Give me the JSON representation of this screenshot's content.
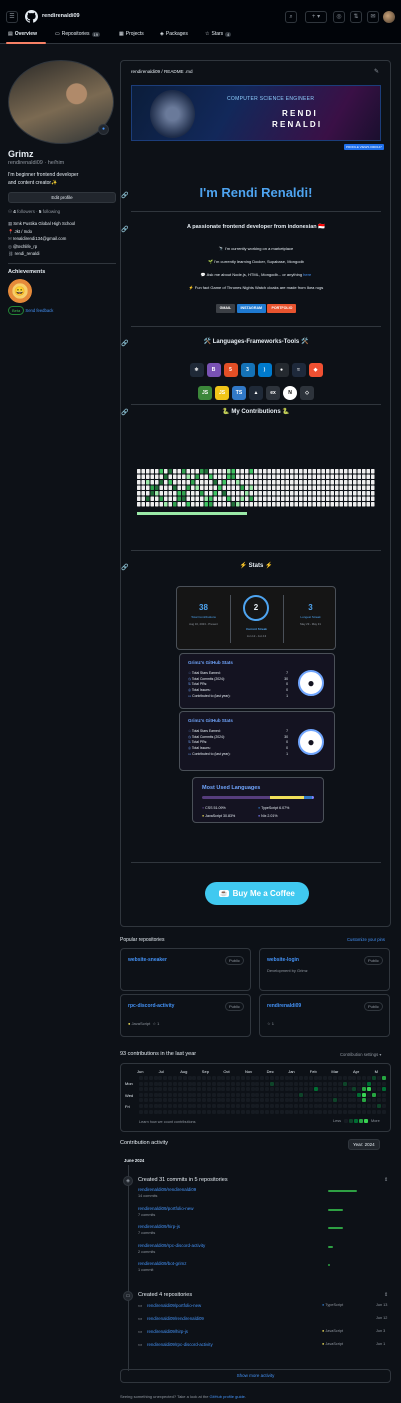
{
  "header": {
    "username": "rendirenaldi09",
    "plus": "+"
  },
  "tabs": [
    {
      "label": "Overview",
      "count": ""
    },
    {
      "label": "Repositories",
      "count": "19"
    },
    {
      "label": "Projects",
      "count": ""
    },
    {
      "label": "Packages",
      "count": ""
    },
    {
      "label": "Stars",
      "count": "4"
    }
  ],
  "profile": {
    "name": "Grimz",
    "login": "rendirenaldi09",
    "pronouns": "he/him",
    "bio_line1": "I'm beginner frontend developer",
    "bio_line2": "and content creator✨",
    "edit_button": "Edit profile",
    "followers_count": "4",
    "followers_label": "followers",
    "following_count": "5",
    "following_label": "following",
    "school": "Smk Pustika Global High School",
    "location": "📍 Jkt / Indo",
    "email": "renaldirendi134@gmail.com",
    "twitter": "@techlife_rp",
    "website": "rendi_renaldi",
    "achievements_title": "Achievements",
    "beta_badge": "Beta",
    "send_feedback": "Send feedback"
  },
  "readme": {
    "path": "rendirenaldi09 / README .md",
    "banner_title": "COMPUTER SCIENCE ENGINEER",
    "banner_name1": "R E N D I",
    "banner_name2": "R E N A L D I",
    "banner_badge": "PROFILE VIEWS 0000147",
    "heading": "I'm Rendi Renaldi!",
    "intro": "A passionate frontend developer from indonesian 🇮🇩",
    "bullet1": "🔭 I'm currently working on a marketplace",
    "bullet2": "🌱 I'm currently learning Docker, Supabase, Mongodb",
    "bullet3a": "💬 Ask me about Node.js, HTML, Mongodb... or anything ",
    "bullet3b": "here",
    "bullet4": "⚡ Fun fact Game of Thrones Nights Watch cloaks are made from Ikea rugs",
    "badges": [
      {
        "label": "GMAIL",
        "color": "#3b3f45"
      },
      {
        "label": "INSTAGRAM",
        "color": "#1f7ad1"
      },
      {
        "label": "PORTFOLIO",
        "color": "#e8542f"
      }
    ],
    "lang_heading": "🛠️ Languages-Frameworks-Tools 🛠️",
    "tech_row1": [
      {
        "icon": "react-icon",
        "glyph": "⚛",
        "color": "#1f2937"
      },
      {
        "icon": "bootstrap-icon",
        "glyph": "B",
        "color": "#7952b3"
      },
      {
        "icon": "html5-icon",
        "glyph": "5",
        "color": "#e34f26"
      },
      {
        "icon": "css3-icon",
        "glyph": "3",
        "color": "#1572b6"
      },
      {
        "icon": "vscode-icon",
        "glyph": "⟩",
        "color": "#007acc"
      },
      {
        "icon": "github-icon",
        "glyph": "●",
        "color": "#24292f"
      },
      {
        "icon": "tailwind-icon",
        "glyph": "≈",
        "color": "#1e293b"
      },
      {
        "icon": "git-icon",
        "glyph": "◆",
        "color": "#f05032"
      }
    ],
    "tech_row2": [
      {
        "icon": "nodejs-icon",
        "glyph": "JS",
        "color": "#3c873a"
      },
      {
        "icon": "javascript-icon",
        "glyph": "JS",
        "color": "#f0c419"
      },
      {
        "icon": "typescript-icon",
        "glyph": "TS",
        "color": "#3178c6"
      },
      {
        "icon": "mongodb-icon",
        "glyph": "▲",
        "color": "#1f2937"
      },
      {
        "icon": "express-icon",
        "glyph": "ex",
        "color": "#2d333b"
      },
      {
        "icon": "nextjs-icon",
        "glyph": "N",
        "color": "#ffffff"
      },
      {
        "icon": "webpack-icon",
        "glyph": "◇",
        "color": "#2d333b"
      }
    ],
    "contrib_heading": "🐍 My Contributions 🐍",
    "stats_heading": "⚡ Stats ⚡",
    "streak": {
      "total": "38",
      "total_label": "Total Contributions",
      "total_range": "Aug 16, 2023 - Present",
      "current": "2",
      "current_label": "Current Streak",
      "current_range": "Jun 12 - Jun 13",
      "longest": "3",
      "longest_label": "Longest Streak",
      "longest_range": "May 29 - May 31"
    },
    "gh_stats_title": "Grimz's GitHub Stats",
    "gh_stats_rows": [
      {
        "label": "Total Stars Earned:",
        "value": "7"
      },
      {
        "label": "Total Commits (2024):",
        "value": "30"
      },
      {
        "label": "Total PRs:",
        "value": "0"
      },
      {
        "label": "Total Issues:",
        "value": "0"
      },
      {
        "label": "Contributed to (last year):",
        "value": "1"
      }
    ],
    "langs_title": "Most Used Languages",
    "langs": [
      {
        "name": "CSS 51.09%",
        "color": "#563d7c"
      },
      {
        "name": "TypeScript 6.07%",
        "color": "#3178c6"
      },
      {
        "name": "JavaScript 30.83%",
        "color": "#f1e05a"
      },
      {
        "name": "Nix 2.01%",
        "color": "#7e7eff"
      }
    ],
    "coffee": "Buy Me a Coffee"
  },
  "popular": {
    "title": "Popular repositories",
    "customize": "Customize your pins",
    "repos": [
      {
        "name": "website-sneaker",
        "vis": "Public",
        "desc": "",
        "lang": "",
        "langcolor": "#f1e05a",
        "stars": ""
      },
      {
        "name": "website-login",
        "vis": "Public",
        "desc": "Development by Grimz",
        "lang": "",
        "langcolor": "#563d7c",
        "stars": ""
      },
      {
        "name": "rpc-discord-activity",
        "vis": "Public",
        "desc": "",
        "lang": "JavaScript",
        "langcolor": "#f1e05a",
        "stars": "1"
      },
      {
        "name": "rendirenaldi09",
        "vis": "Public",
        "desc": "",
        "lang": "",
        "langcolor": "",
        "stars": "1"
      }
    ]
  },
  "graph": {
    "title": "93 contributions in the last year",
    "settings": "Contribution settings ▾",
    "months": [
      "Jun",
      "Jul",
      "Aug",
      "Sep",
      "Oct",
      "Nov",
      "Dec",
      "Jan",
      "Feb",
      "Mar",
      "Apr",
      "M"
    ],
    "days": [
      "Mon",
      "Wed",
      "Fri"
    ],
    "learn": "Learn how we count contributions",
    "less": "Less",
    "more": "More"
  },
  "activity": {
    "title": "Contribution activity",
    "year_button": "Year: 2024",
    "month": "June 2024",
    "commits_title": "Created 31 commits in 5 repositories",
    "commits": [
      {
        "repo": "rendirenaldi09/rendirenaldi09",
        "count": "14 commits",
        "bar": 0.85
      },
      {
        "repo": "rendirenaldi09/portfolio-new",
        "count": "7 commits",
        "bar": 0.45
      },
      {
        "repo": "rendirenaldi09/hirp-js",
        "count": "7 commits",
        "bar": 0.45
      },
      {
        "repo": "rendirenaldi09/rpc-discord-activity",
        "count": "2 commits",
        "bar": 0.15
      },
      {
        "repo": "rendirenaldi09/bot-grimz",
        "count": "1 commit",
        "bar": 0.07
      }
    ],
    "repos_title": "Created 4 repositories",
    "created": [
      {
        "repo": "rendirenaldi09/portfolio-new",
        "lang": "TypeScript",
        "color": "#3178c6",
        "date": "Jun 13"
      },
      {
        "repo": "rendirenaldi09/rendirenaldi09",
        "lang": "",
        "color": "",
        "date": "Jun 12"
      },
      {
        "repo": "rendirenaldi09/hirp-js",
        "lang": "JavaScript",
        "color": "#f1e05a",
        "date": "Jun 3"
      },
      {
        "repo": "rendirenaldi09/rpc-discord-activity",
        "lang": "JavaScript",
        "color": "#f1e05a",
        "date": "Jun 1"
      }
    ],
    "show_more": "Show more activity",
    "footer_a": "Seeing something unexpected? Take a look at the ",
    "footer_link": "GitHub profile guide",
    "footer_b": "."
  }
}
